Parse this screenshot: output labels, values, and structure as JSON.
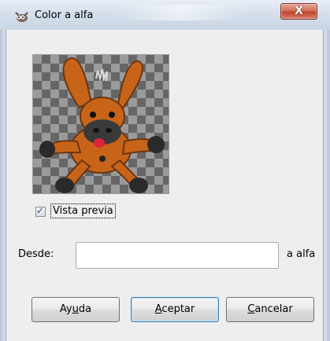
{
  "window": {
    "title": "Color a alfa",
    "close_glyph": "X",
    "app_icon": "gimp-wilber-icon"
  },
  "preview": {
    "image": "donkey-plush-transparent-background"
  },
  "checkbox": {
    "label": "Vista previa",
    "checked": true
  },
  "form": {
    "from_label": "Desde:",
    "from_value": "",
    "to_label": "a alfa"
  },
  "buttons": {
    "help": {
      "before": "Ay",
      "mnemonic": "u",
      "after": "da"
    },
    "ok": {
      "before": "",
      "mnemonic": "A",
      "after": "ceptar"
    },
    "cancel": {
      "before": "",
      "mnemonic": "C",
      "after": "ancelar"
    }
  },
  "colors": {
    "close_button": "#c0432b",
    "default_button_border": "#3c7fb1",
    "checkmark": "#2a4f9a"
  }
}
